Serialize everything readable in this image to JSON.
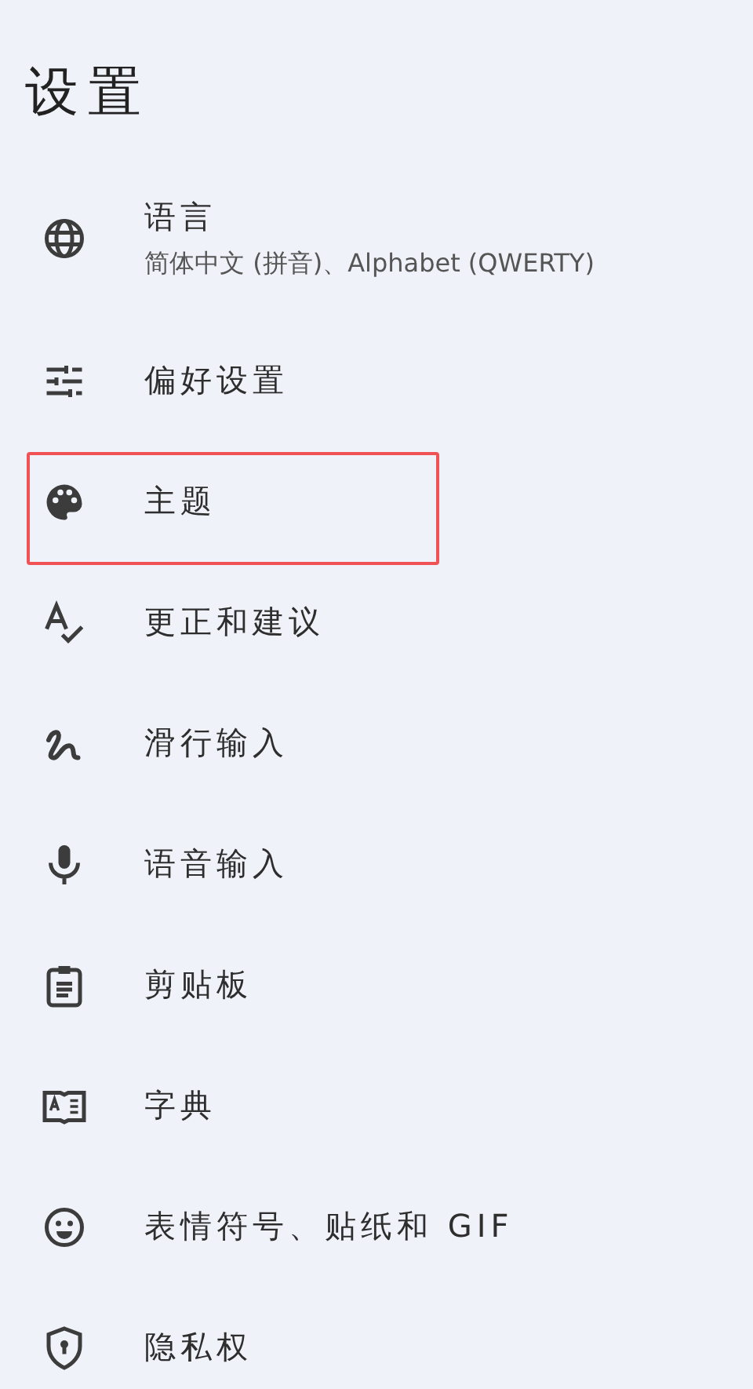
{
  "title": "设置",
  "items": [
    {
      "label": "语言",
      "summary": "简体中文 (拼音)、Alphabet (QWERTY)",
      "highlighted": false
    },
    {
      "label": "偏好设置",
      "highlighted": false
    },
    {
      "label": "主题",
      "highlighted": true
    },
    {
      "label": "更正和建议",
      "highlighted": false
    },
    {
      "label": "滑行输入",
      "highlighted": false
    },
    {
      "label": "语音输入",
      "highlighted": false
    },
    {
      "label": "剪贴板",
      "highlighted": false
    },
    {
      "label": "字典",
      "highlighted": false
    },
    {
      "label": "表情符号、贴纸和 GIF",
      "highlighted": false
    },
    {
      "label": "隐私权",
      "highlighted": false
    }
  ]
}
